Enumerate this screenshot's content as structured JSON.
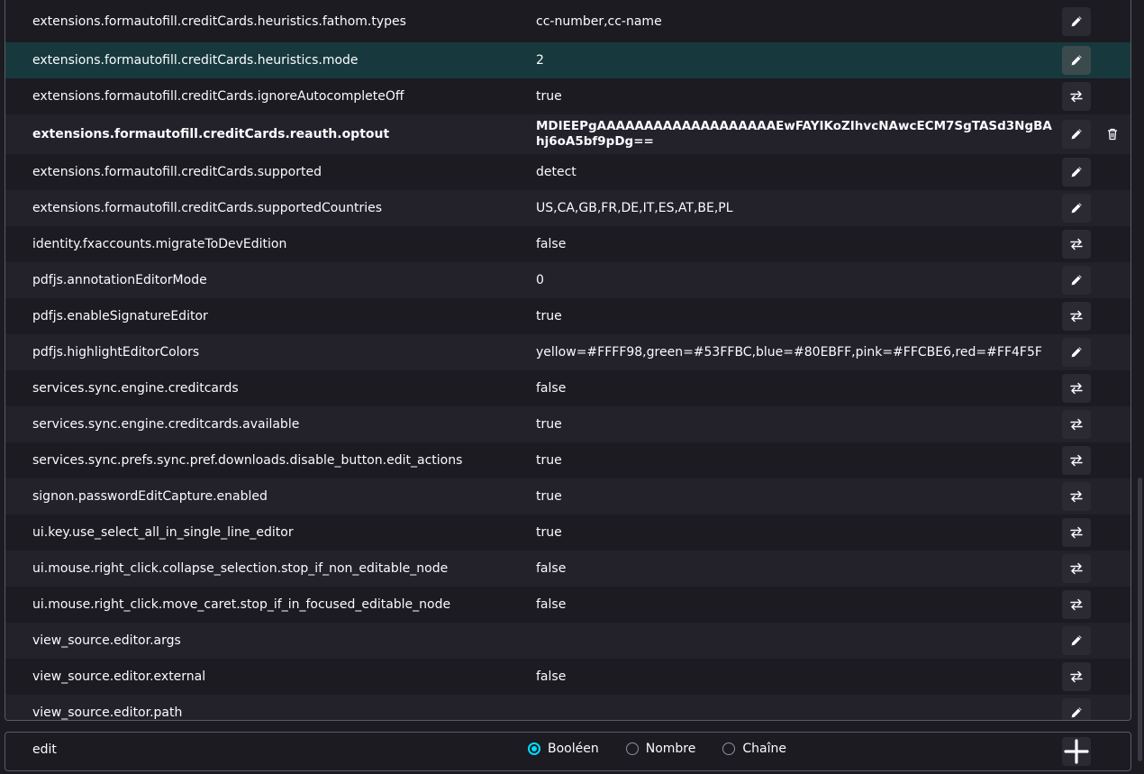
{
  "prefs": [
    {
      "name": "extensions.formautofill.creditCards.heuristics.fathom.types",
      "value": "cc-number,cc-name",
      "action": "edit",
      "state": "normal"
    },
    {
      "name": "extensions.formautofill.creditCards.heuristics.mode",
      "value": "2",
      "action": "edit",
      "state": "selected"
    },
    {
      "name": "extensions.formautofill.creditCards.ignoreAutocompleteOff",
      "value": "true",
      "action": "toggle",
      "state": "normal"
    },
    {
      "name": "extensions.formautofill.creditCards.reauth.optout",
      "value": "MDIEEPgAAAAAAAAAAAAAAAAAAAEwFAYIKoZIhvcNAwcECM7SgTASd3NgBAhj6oA5bf9pDg==",
      "action": "edit",
      "state": "modified"
    },
    {
      "name": "extensions.formautofill.creditCards.supported",
      "value": "detect",
      "action": "edit",
      "state": "normal"
    },
    {
      "name": "extensions.formautofill.creditCards.supportedCountries",
      "value": "US,CA,GB,FR,DE,IT,ES,AT,BE,PL",
      "action": "edit",
      "state": "normal"
    },
    {
      "name": "identity.fxaccounts.migrateToDevEdition",
      "value": "false",
      "action": "toggle",
      "state": "normal"
    },
    {
      "name": "pdfjs.annotationEditorMode",
      "value": "0",
      "action": "edit",
      "state": "normal"
    },
    {
      "name": "pdfjs.enableSignatureEditor",
      "value": "true",
      "action": "toggle",
      "state": "normal"
    },
    {
      "name": "pdfjs.highlightEditorColors",
      "value": "yellow=#FFFF98,green=#53FFBC,blue=#80EBFF,pink=#FFCBE6,red=#FF4F5F",
      "action": "edit",
      "state": "normal"
    },
    {
      "name": "services.sync.engine.creditcards",
      "value": "false",
      "action": "toggle",
      "state": "normal"
    },
    {
      "name": "services.sync.engine.creditcards.available",
      "value": "true",
      "action": "toggle",
      "state": "normal"
    },
    {
      "name": "services.sync.prefs.sync.pref.downloads.disable_button.edit_actions",
      "value": "true",
      "action": "toggle",
      "state": "normal"
    },
    {
      "name": "signon.passwordEditCapture.enabled",
      "value": "true",
      "action": "toggle",
      "state": "normal"
    },
    {
      "name": "ui.key.use_select_all_in_single_line_editor",
      "value": "true",
      "action": "toggle",
      "state": "normal"
    },
    {
      "name": "ui.mouse.right_click.collapse_selection.stop_if_non_editable_node",
      "value": "false",
      "action": "toggle",
      "state": "normal"
    },
    {
      "name": "ui.mouse.right_click.move_caret.stop_if_in_focused_editable_node",
      "value": "false",
      "action": "toggle",
      "state": "normal"
    },
    {
      "name": "view_source.editor.args",
      "value": "",
      "action": "edit",
      "state": "normal"
    },
    {
      "name": "view_source.editor.external",
      "value": "false",
      "action": "toggle",
      "state": "normal"
    },
    {
      "name": "view_source.editor.path",
      "value": "",
      "action": "edit",
      "state": "normal"
    }
  ],
  "add_row": {
    "name": "edit",
    "types": [
      {
        "label": "Booléen",
        "checked": true
      },
      {
        "label": "Nombre",
        "checked": false
      },
      {
        "label": "Chaîne",
        "checked": false
      }
    ]
  },
  "colors": {
    "accent": "#00ddff",
    "selected_row": "#17393d",
    "alt_row": "#23222b"
  },
  "icons": {
    "edit": "pencil-icon",
    "toggle": "toggle-arrows-icon",
    "reset": "trash-icon",
    "add": "plus-icon"
  }
}
